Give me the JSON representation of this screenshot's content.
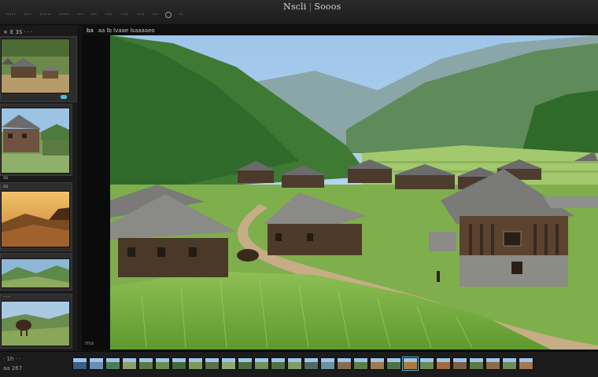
{
  "window": {
    "title_left": "Nscli",
    "title_right": "Sooos"
  },
  "menu": {
    "items": [
      "·····",
      "····",
      "······",
      "·····",
      "···",
      "···",
      "····",
      "····",
      "····",
      "···",
      "··"
    ]
  },
  "sidebar": {
    "header_close": "×",
    "header_label": "E 3S · · ·",
    "captions": [
      "ss",
      "ss",
      "·····",
      "··",
      "····",
      "···"
    ]
  },
  "viewer": {
    "header_tag": "ba",
    "header_text": "aa lb lvaae lsaaaaeo",
    "corner_mark": "ma"
  },
  "filmstrip": {
    "info_line1": "· 1h · ·",
    "info_line2": "aa 267",
    "thumb_count": 28,
    "active_index": 20,
    "thumb_colors": [
      "#3a5f86",
      "#6b8fb0",
      "#4d7d58",
      "#8aa06a",
      "#5b7a3f",
      "#6a8d4e",
      "#3f6b3a",
      "#7a9a58",
      "#5a6e4a",
      "#8ea774",
      "#4c6d3d",
      "#6f8f5d",
      "#516f46",
      "#7f9c66",
      "#4f6a5b",
      "#6b8fa5",
      "#866b4f",
      "#5b7e48",
      "#9a7a4e",
      "#4f7242",
      "#b07a3e",
      "#6a8a52",
      "#a46a3a",
      "#7a6046",
      "#5d7a46",
      "#8c6a4a",
      "#6e8c5a",
      "#a67650"
    ]
  }
}
